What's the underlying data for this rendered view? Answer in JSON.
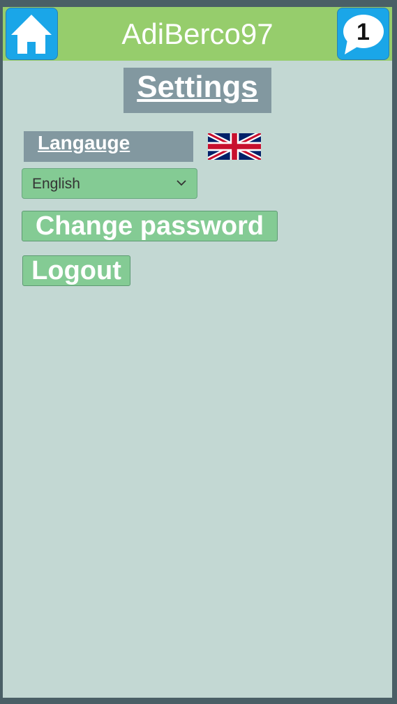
{
  "header": {
    "username": "AdiBerco97",
    "home_icon": "home-icon",
    "notification_icon": "speech-bubble-icon",
    "notification_count": "1"
  },
  "settings": {
    "title": "Settings",
    "language_label": "Langauge",
    "language_flag": "uk-flag-icon",
    "language_selected": "English",
    "change_password_label": "Change password",
    "logout_label": "Logout"
  },
  "colors": {
    "header_bg": "#96cd6c",
    "page_bg": "#c3d8d3",
    "icon_button_bg": "#1aa6e8",
    "label_bg": "#8298a0",
    "button_bg": "#84cb94"
  }
}
